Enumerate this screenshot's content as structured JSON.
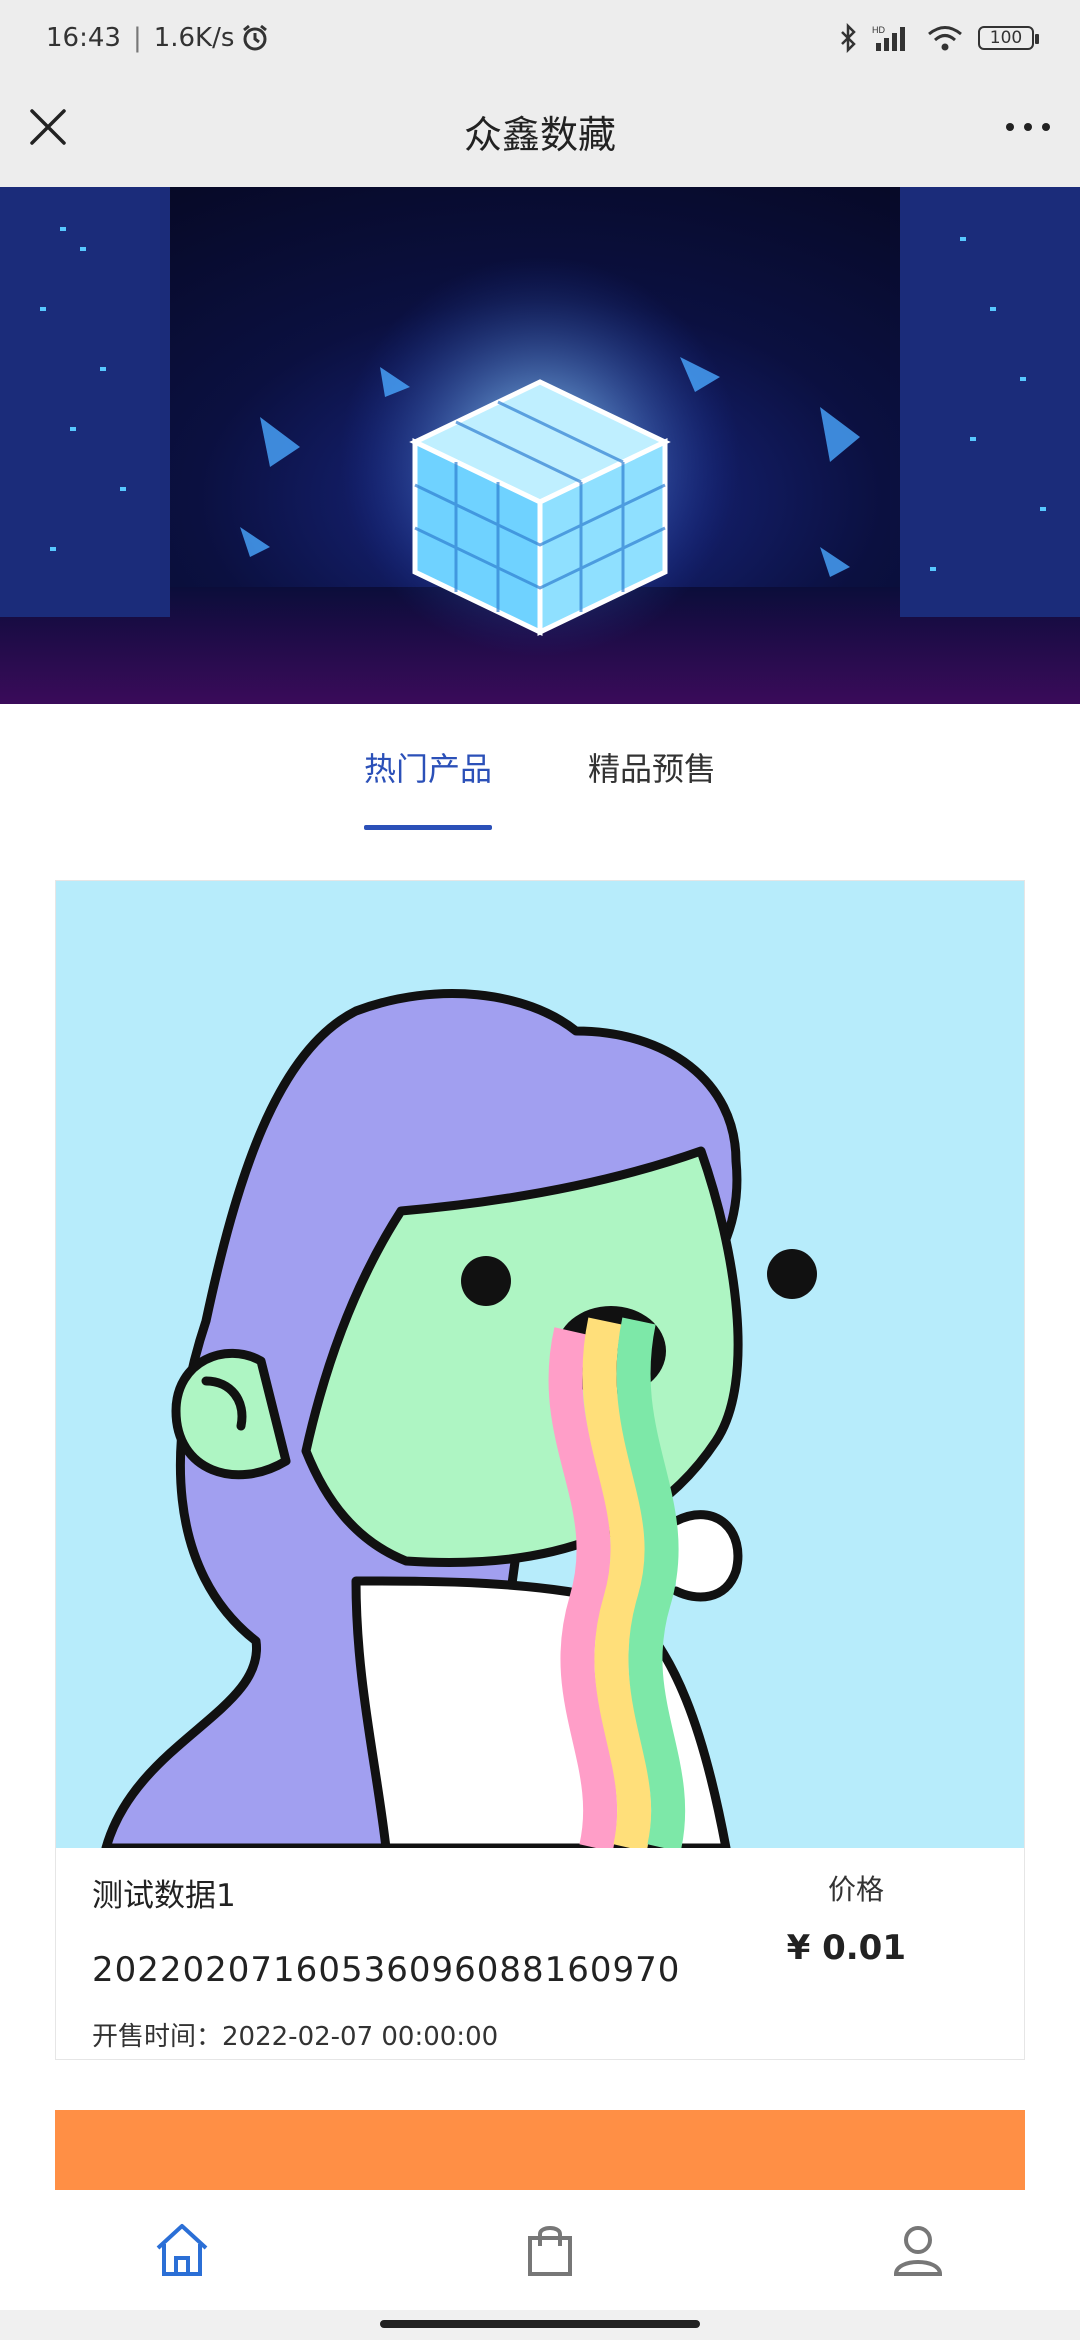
{
  "status_bar": {
    "time": "16:43",
    "separator": "|",
    "net_speed": "1.6K/s",
    "battery": "100",
    "icons": [
      "alarm-icon",
      "bluetooth-icon",
      "signal-icon",
      "wifi-icon",
      "battery-icon"
    ]
  },
  "nav": {
    "title": "众鑫数藏",
    "close_icon": "close-icon",
    "more_icon": "more-icon"
  },
  "tabs": [
    {
      "label": "热门产品",
      "active": true
    },
    {
      "label": "精品预售",
      "active": false
    }
  ],
  "product": {
    "name": "测试数据1",
    "id": "20220207160536096088160970",
    "sale_time_label": "开售时间：",
    "sale_time": "2022-02-07 00:00:00",
    "price_label": "价格",
    "price": "¥ 0.01"
  },
  "bottom_nav": [
    {
      "name": "home",
      "icon": "home-icon",
      "active": true
    },
    {
      "name": "shop",
      "icon": "shopping-bag-icon",
      "active": false
    },
    {
      "name": "profile",
      "icon": "user-icon",
      "active": false
    }
  ],
  "colors": {
    "accent": "#2b50b8",
    "orange": "#ff8f45",
    "art_bg": "#b7ecfb"
  }
}
